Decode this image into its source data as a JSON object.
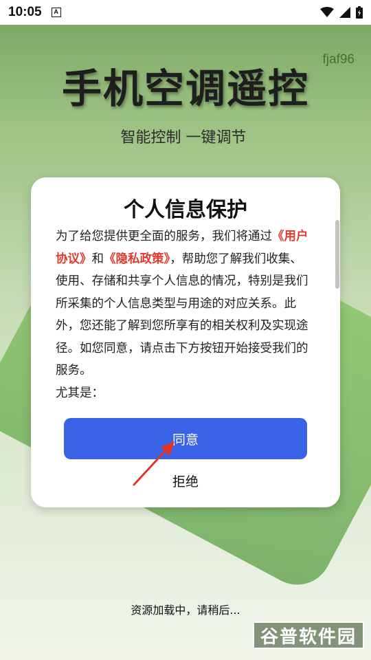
{
  "status_bar": {
    "time": "10:05",
    "indicator": "A"
  },
  "app": {
    "title": "手机空调遥控",
    "watermark_id": "fjaf96",
    "subtitle": "智能控制 一键调节"
  },
  "dialog": {
    "title": "个人信息保护",
    "body_intro": "为了给您提供更全面的服务，我们将通过",
    "link_user_agreement": "《用户协议》",
    "body_and": "和",
    "link_privacy_policy": "《隐私政策》",
    "body_main": "，帮助您了解我们收集、使用、存储和共享个人信息的情况，特别是我们所采集的个人信息类型与用途的对应关系。此外，您还能了解到您所享有的相关权利及实现途径。如您同意，请点击下方按钮开始接受我们的服务。",
    "body_more": "尤其是：",
    "agree_label": "同意",
    "reject_label": "拒绝"
  },
  "footer": {
    "loading_text": "资源加载中，请稍后...",
    "brand": "谷普软件园"
  },
  "colors": {
    "accent": "#3a63e7",
    "link": "#e33a2e"
  }
}
